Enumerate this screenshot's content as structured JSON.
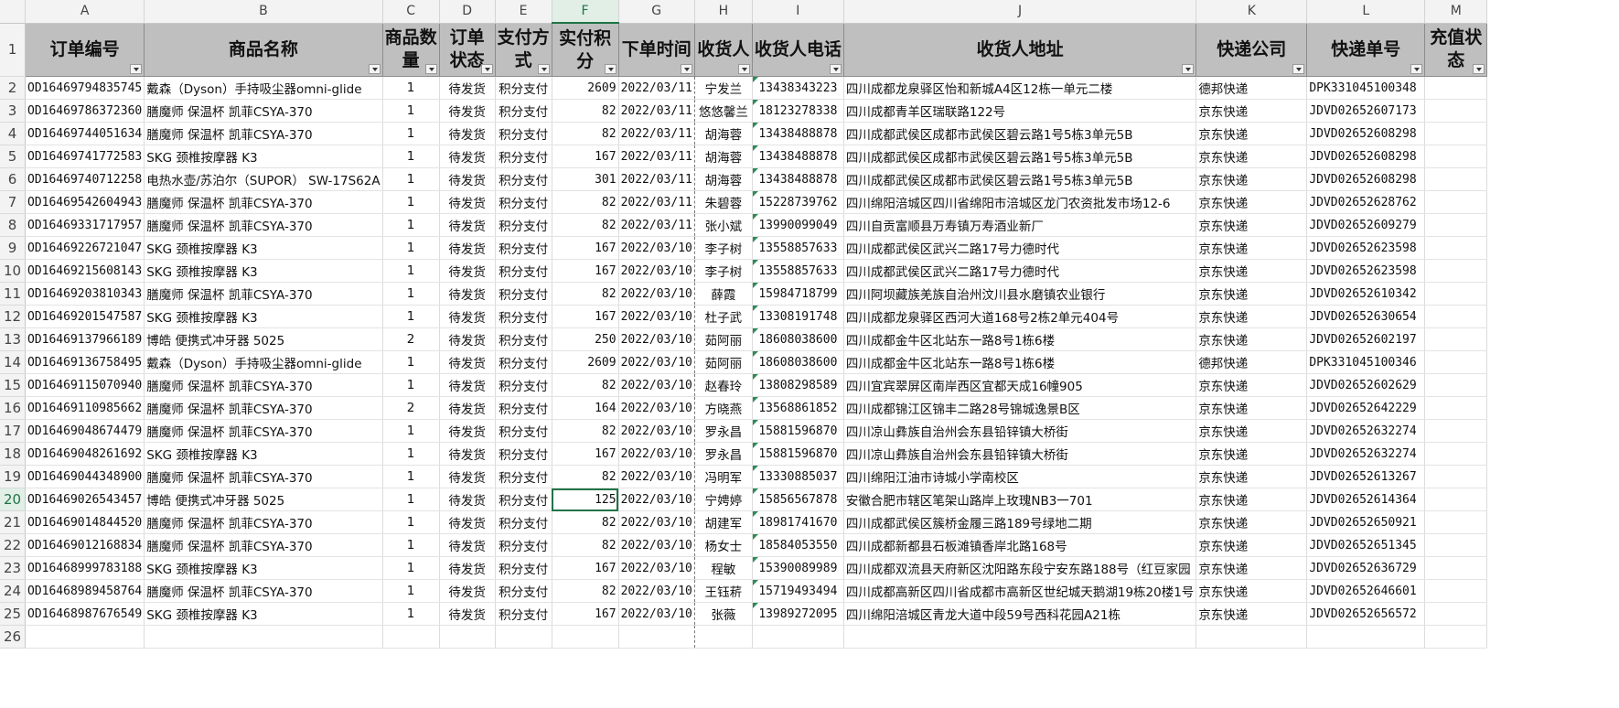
{
  "columns": [
    "A",
    "B",
    "C",
    "D",
    "E",
    "F",
    "G",
    "H",
    "I",
    "J",
    "K",
    "L",
    "M"
  ],
  "selected_column": "F",
  "selected_row": 20,
  "headers": [
    "订单编号",
    "商品名称",
    "商品数量",
    "订单状态",
    "支付方式",
    "实付积分",
    "下单时间",
    "收货人",
    "收货人电话",
    "收货人地址",
    "快递公司",
    "快递单号",
    "充值状态"
  ],
  "rows": [
    {
      "n": 2,
      "cells": [
        "OD16469794835745",
        "戴森（Dyson）手持吸尘器omni-glide",
        "1",
        "待发货",
        "积分支付",
        "2609",
        "2022/03/11",
        "宁发兰",
        "13438343223",
        "四川成都龙泉驿区怡和新城A4区12栋一单元二楼",
        "德邦快递",
        "DPK331045100348",
        ""
      ]
    },
    {
      "n": 3,
      "cells": [
        "OD16469786372360",
        "膳魔师 保温杯 凯菲CSYA-370",
        "1",
        "待发货",
        "积分支付",
        "82",
        "2022/03/11",
        "悠悠馨兰",
        "18123278338",
        "四川成都青羊区瑞联路122号",
        "京东快递",
        "JDVD02652607173",
        ""
      ]
    },
    {
      "n": 4,
      "cells": [
        "OD16469744051634",
        "膳魔师 保温杯 凯菲CSYA-370",
        "1",
        "待发货",
        "积分支付",
        "82",
        "2022/03/11",
        "胡海蓉",
        "13438488878",
        "四川成都武侯区成都市武侯区碧云路1号5栋3单元5B",
        "京东快递",
        "JDVD02652608298",
        ""
      ]
    },
    {
      "n": 5,
      "cells": [
        "OD16469741772583",
        "SKG 颈椎按摩器 K3",
        "1",
        "待发货",
        "积分支付",
        "167",
        "2022/03/11",
        "胡海蓉",
        "13438488878",
        "四川成都武侯区成都市武侯区碧云路1号5栋3单元5B",
        "京东快递",
        "JDVD02652608298",
        ""
      ]
    },
    {
      "n": 6,
      "cells": [
        "OD16469740712258",
        "电热水壶/苏泊尔（SUPOR） SW-17S62A",
        "1",
        "待发货",
        "积分支付",
        "301",
        "2022/03/11",
        "胡海蓉",
        "13438488878",
        "四川成都武侯区成都市武侯区碧云路1号5栋3单元5B",
        "京东快递",
        "JDVD02652608298",
        ""
      ]
    },
    {
      "n": 7,
      "cells": [
        "OD16469542604943",
        "膳魔师 保温杯 凯菲CSYA-370",
        "1",
        "待发货",
        "积分支付",
        "82",
        "2022/03/11",
        "朱碧蓉",
        "15228739762",
        "四川绵阳涪城区四川省绵阳市涪城区龙门农资批发市场12-6",
        "京东快递",
        "JDVD02652628762",
        ""
      ]
    },
    {
      "n": 8,
      "cells": [
        "OD16469331717957",
        "膳魔师 保温杯 凯菲CSYA-370",
        "1",
        "待发货",
        "积分支付",
        "82",
        "2022/03/11",
        "张小斌",
        "13990099049",
        "四川自贡富顺县万寿镇万寿酒业新厂",
        "京东快递",
        "JDVD02652609279",
        ""
      ]
    },
    {
      "n": 9,
      "cells": [
        "OD16469226721047",
        "SKG 颈椎按摩器 K3",
        "1",
        "待发货",
        "积分支付",
        "167",
        "2022/03/10",
        "李子树",
        "13558857633",
        "四川成都武侯区武兴二路17号力德时代",
        "京东快递",
        "JDVD02652623598",
        ""
      ]
    },
    {
      "n": 10,
      "cells": [
        "OD16469215608143",
        "SKG 颈椎按摩器 K3",
        "1",
        "待发货",
        "积分支付",
        "167",
        "2022/03/10",
        "李子树",
        "13558857633",
        "四川成都武侯区武兴二路17号力德时代",
        "京东快递",
        "JDVD02652623598",
        ""
      ]
    },
    {
      "n": 11,
      "cells": [
        "OD16469203810343",
        "膳魔师 保温杯 凯菲CSYA-370",
        "1",
        "待发货",
        "积分支付",
        "82",
        "2022/03/10",
        "薛霞",
        "15984718799",
        "四川阿坝藏族羌族自治州汶川县水磨镇农业银行",
        "京东快递",
        "JDVD02652610342",
        ""
      ]
    },
    {
      "n": 12,
      "cells": [
        "OD16469201547587",
        "SKG 颈椎按摩器 K3",
        "1",
        "待发货",
        "积分支付",
        "167",
        "2022/03/10",
        "杜子武",
        "13308191748",
        "四川成都龙泉驿区西河大道168号2栋2单元404号",
        "京东快递",
        "JDVD02652630654",
        ""
      ]
    },
    {
      "n": 13,
      "cells": [
        "OD16469137966189",
        "博皓 便携式冲牙器 5025",
        "2",
        "待发货",
        "积分支付",
        "250",
        "2022/03/10",
        "茹阿丽",
        "18608038600",
        "四川成都金牛区北站东一路8号1栋6楼",
        "京东快递",
        "JDVD02652602197",
        ""
      ]
    },
    {
      "n": 14,
      "cells": [
        "OD16469136758495",
        "戴森（Dyson）手持吸尘器omni-glide",
        "1",
        "待发货",
        "积分支付",
        "2609",
        "2022/03/10",
        "茹阿丽",
        "18608038600",
        "四川成都金牛区北站东一路8号1栋6楼",
        "德邦快递",
        "DPK331045100346",
        ""
      ]
    },
    {
      "n": 15,
      "cells": [
        "OD16469115070940",
        "膳魔师 保温杯 凯菲CSYA-370",
        "1",
        "待发货",
        "积分支付",
        "82",
        "2022/03/10",
        "赵春玲",
        "13808298589",
        "四川宜宾翠屏区南岸西区宜都天成16幢905",
        "京东快递",
        "JDVD02652602629",
        ""
      ]
    },
    {
      "n": 16,
      "cells": [
        "OD16469110985662",
        "膳魔师 保温杯 凯菲CSYA-370",
        "2",
        "待发货",
        "积分支付",
        "164",
        "2022/03/10",
        "方晓燕",
        "13568861852",
        "四川成都锦江区锦丰二路28号锦城逸景B区",
        "京东快递",
        "JDVD02652642229",
        ""
      ]
    },
    {
      "n": 17,
      "cells": [
        "OD16469048674479",
        "膳魔师 保温杯 凯菲CSYA-370",
        "1",
        "待发货",
        "积分支付",
        "82",
        "2022/03/10",
        "罗永昌",
        "15881596870",
        "四川凉山彝族自治州会东县铅锌镇大桥街",
        "京东快递",
        "JDVD02652632274",
        ""
      ]
    },
    {
      "n": 18,
      "cells": [
        "OD16469048261692",
        "SKG 颈椎按摩器 K3",
        "1",
        "待发货",
        "积分支付",
        "167",
        "2022/03/10",
        "罗永昌",
        "15881596870",
        "四川凉山彝族自治州会东县铅锌镇大桥街",
        "京东快递",
        "JDVD02652632274",
        ""
      ]
    },
    {
      "n": 19,
      "cells": [
        "OD16469044348900",
        "膳魔师 保温杯 凯菲CSYA-370",
        "1",
        "待发货",
        "积分支付",
        "82",
        "2022/03/10",
        "冯明军",
        "13330885037",
        "四川绵阳江油市诗城小学南校区",
        "京东快递",
        "JDVD02652613267",
        ""
      ]
    },
    {
      "n": 20,
      "cells": [
        "OD16469026543457",
        "博皓 便携式冲牙器 5025",
        "1",
        "待发货",
        "积分支付",
        "125",
        "2022/03/10",
        "宁娉婷",
        "15856567878",
        "安徽合肥市辖区笔架山路岸上玫瑰NB3一701",
        "京东快递",
        "JDVD02652614364",
        ""
      ]
    },
    {
      "n": 21,
      "cells": [
        "OD16469014844520",
        "膳魔师 保温杯 凯菲CSYA-370",
        "1",
        "待发货",
        "积分支付",
        "82",
        "2022/03/10",
        "胡建军",
        "18981741670",
        "四川成都武侯区簇桥金履三路189号绿地二期",
        "京东快递",
        "JDVD02652650921",
        ""
      ]
    },
    {
      "n": 22,
      "cells": [
        "OD16469012168834",
        "膳魔师 保温杯 凯菲CSYA-370",
        "1",
        "待发货",
        "积分支付",
        "82",
        "2022/03/10",
        "杨女士",
        "18584053550",
        "四川成都新都县石板滩镇香岸北路168号",
        "京东快递",
        "JDVD02652651345",
        ""
      ]
    },
    {
      "n": 23,
      "cells": [
        "OD16468999783188",
        "SKG 颈椎按摩器 K3",
        "1",
        "待发货",
        "积分支付",
        "167",
        "2022/03/10",
        "程敏",
        "15390089989",
        "四川成都双流县天府新区沈阳路东段宁安东路188号（红豆家园",
        "京东快递",
        "JDVD02652636729",
        ""
      ]
    },
    {
      "n": 24,
      "cells": [
        "OD16468989458764",
        "膳魔师 保温杯 凯菲CSYA-370",
        "1",
        "待发货",
        "积分支付",
        "82",
        "2022/03/10",
        "王钰菥",
        "15719493494",
        "四川成都高新区四川省成都市高新区世纪城天鹅湖19栋20楼1号",
        "京东快递",
        "JDVD02652646601",
        ""
      ]
    },
    {
      "n": 25,
      "cells": [
        "OD16468987676549",
        "SKG 颈椎按摩器 K3",
        "1",
        "待发货",
        "积分支付",
        "167",
        "2022/03/10",
        "张薇",
        "13989272095",
        "四川绵阳涪城区青龙大道中段59号西科花园A21栋",
        "京东快递",
        "JDVD02652656572",
        ""
      ]
    }
  ],
  "empty_row_number": 26
}
